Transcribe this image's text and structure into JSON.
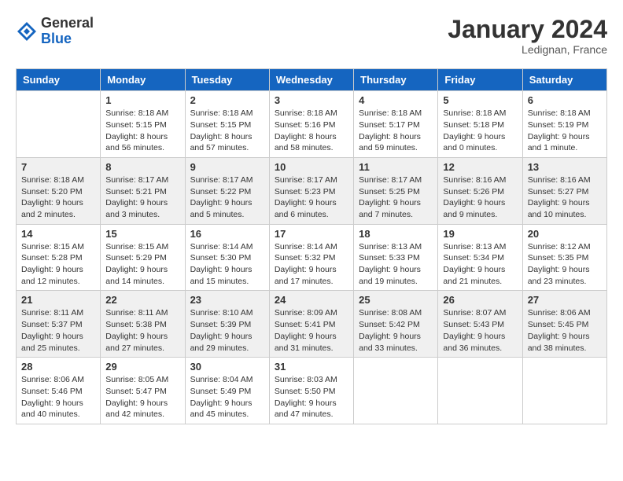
{
  "logo": {
    "general": "General",
    "blue": "Blue"
  },
  "title": "January 2024",
  "location": "Ledignan, France",
  "headers": [
    "Sunday",
    "Monday",
    "Tuesday",
    "Wednesday",
    "Thursday",
    "Friday",
    "Saturday"
  ],
  "weeks": [
    [
      {
        "day": "",
        "sunrise": "",
        "sunset": "",
        "daylight": ""
      },
      {
        "day": "1",
        "sunrise": "Sunrise: 8:18 AM",
        "sunset": "Sunset: 5:15 PM",
        "daylight": "Daylight: 8 hours and 56 minutes."
      },
      {
        "day": "2",
        "sunrise": "Sunrise: 8:18 AM",
        "sunset": "Sunset: 5:15 PM",
        "daylight": "Daylight: 8 hours and 57 minutes."
      },
      {
        "day": "3",
        "sunrise": "Sunrise: 8:18 AM",
        "sunset": "Sunset: 5:16 PM",
        "daylight": "Daylight: 8 hours and 58 minutes."
      },
      {
        "day": "4",
        "sunrise": "Sunrise: 8:18 AM",
        "sunset": "Sunset: 5:17 PM",
        "daylight": "Daylight: 8 hours and 59 minutes."
      },
      {
        "day": "5",
        "sunrise": "Sunrise: 8:18 AM",
        "sunset": "Sunset: 5:18 PM",
        "daylight": "Daylight: 9 hours and 0 minutes."
      },
      {
        "day": "6",
        "sunrise": "Sunrise: 8:18 AM",
        "sunset": "Sunset: 5:19 PM",
        "daylight": "Daylight: 9 hours and 1 minute."
      }
    ],
    [
      {
        "day": "7",
        "sunrise": "Sunrise: 8:18 AM",
        "sunset": "Sunset: 5:20 PM",
        "daylight": "Daylight: 9 hours and 2 minutes."
      },
      {
        "day": "8",
        "sunrise": "Sunrise: 8:17 AM",
        "sunset": "Sunset: 5:21 PM",
        "daylight": "Daylight: 9 hours and 3 minutes."
      },
      {
        "day": "9",
        "sunrise": "Sunrise: 8:17 AM",
        "sunset": "Sunset: 5:22 PM",
        "daylight": "Daylight: 9 hours and 5 minutes."
      },
      {
        "day": "10",
        "sunrise": "Sunrise: 8:17 AM",
        "sunset": "Sunset: 5:23 PM",
        "daylight": "Daylight: 9 hours and 6 minutes."
      },
      {
        "day": "11",
        "sunrise": "Sunrise: 8:17 AM",
        "sunset": "Sunset: 5:25 PM",
        "daylight": "Daylight: 9 hours and 7 minutes."
      },
      {
        "day": "12",
        "sunrise": "Sunrise: 8:16 AM",
        "sunset": "Sunset: 5:26 PM",
        "daylight": "Daylight: 9 hours and 9 minutes."
      },
      {
        "day": "13",
        "sunrise": "Sunrise: 8:16 AM",
        "sunset": "Sunset: 5:27 PM",
        "daylight": "Daylight: 9 hours and 10 minutes."
      }
    ],
    [
      {
        "day": "14",
        "sunrise": "Sunrise: 8:15 AM",
        "sunset": "Sunset: 5:28 PM",
        "daylight": "Daylight: 9 hours and 12 minutes."
      },
      {
        "day": "15",
        "sunrise": "Sunrise: 8:15 AM",
        "sunset": "Sunset: 5:29 PM",
        "daylight": "Daylight: 9 hours and 14 minutes."
      },
      {
        "day": "16",
        "sunrise": "Sunrise: 8:14 AM",
        "sunset": "Sunset: 5:30 PM",
        "daylight": "Daylight: 9 hours and 15 minutes."
      },
      {
        "day": "17",
        "sunrise": "Sunrise: 8:14 AM",
        "sunset": "Sunset: 5:32 PM",
        "daylight": "Daylight: 9 hours and 17 minutes."
      },
      {
        "day": "18",
        "sunrise": "Sunrise: 8:13 AM",
        "sunset": "Sunset: 5:33 PM",
        "daylight": "Daylight: 9 hours and 19 minutes."
      },
      {
        "day": "19",
        "sunrise": "Sunrise: 8:13 AM",
        "sunset": "Sunset: 5:34 PM",
        "daylight": "Daylight: 9 hours and 21 minutes."
      },
      {
        "day": "20",
        "sunrise": "Sunrise: 8:12 AM",
        "sunset": "Sunset: 5:35 PM",
        "daylight": "Daylight: 9 hours and 23 minutes."
      }
    ],
    [
      {
        "day": "21",
        "sunrise": "Sunrise: 8:11 AM",
        "sunset": "Sunset: 5:37 PM",
        "daylight": "Daylight: 9 hours and 25 minutes."
      },
      {
        "day": "22",
        "sunrise": "Sunrise: 8:11 AM",
        "sunset": "Sunset: 5:38 PM",
        "daylight": "Daylight: 9 hours and 27 minutes."
      },
      {
        "day": "23",
        "sunrise": "Sunrise: 8:10 AM",
        "sunset": "Sunset: 5:39 PM",
        "daylight": "Daylight: 9 hours and 29 minutes."
      },
      {
        "day": "24",
        "sunrise": "Sunrise: 8:09 AM",
        "sunset": "Sunset: 5:41 PM",
        "daylight": "Daylight: 9 hours and 31 minutes."
      },
      {
        "day": "25",
        "sunrise": "Sunrise: 8:08 AM",
        "sunset": "Sunset: 5:42 PM",
        "daylight": "Daylight: 9 hours and 33 minutes."
      },
      {
        "day": "26",
        "sunrise": "Sunrise: 8:07 AM",
        "sunset": "Sunset: 5:43 PM",
        "daylight": "Daylight: 9 hours and 36 minutes."
      },
      {
        "day": "27",
        "sunrise": "Sunrise: 8:06 AM",
        "sunset": "Sunset: 5:45 PM",
        "daylight": "Daylight: 9 hours and 38 minutes."
      }
    ],
    [
      {
        "day": "28",
        "sunrise": "Sunrise: 8:06 AM",
        "sunset": "Sunset: 5:46 PM",
        "daylight": "Daylight: 9 hours and 40 minutes."
      },
      {
        "day": "29",
        "sunrise": "Sunrise: 8:05 AM",
        "sunset": "Sunset: 5:47 PM",
        "daylight": "Daylight: 9 hours and 42 minutes."
      },
      {
        "day": "30",
        "sunrise": "Sunrise: 8:04 AM",
        "sunset": "Sunset: 5:49 PM",
        "daylight": "Daylight: 9 hours and 45 minutes."
      },
      {
        "day": "31",
        "sunrise": "Sunrise: 8:03 AM",
        "sunset": "Sunset: 5:50 PM",
        "daylight": "Daylight: 9 hours and 47 minutes."
      },
      {
        "day": "",
        "sunrise": "",
        "sunset": "",
        "daylight": ""
      },
      {
        "day": "",
        "sunrise": "",
        "sunset": "",
        "daylight": ""
      },
      {
        "day": "",
        "sunrise": "",
        "sunset": "",
        "daylight": ""
      }
    ]
  ],
  "row_shading": [
    false,
    true,
    false,
    true,
    false
  ]
}
